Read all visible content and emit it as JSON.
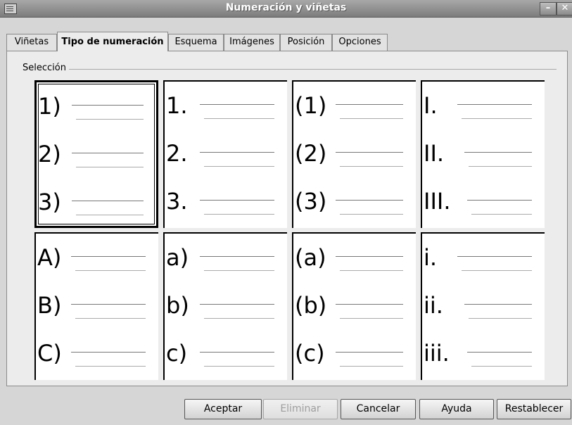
{
  "window": {
    "title": "Numeración y viñetas",
    "minimize": "–",
    "close": "✕"
  },
  "tabs": [
    {
      "label": "Viñetas",
      "active": false
    },
    {
      "label": "Tipo de numeración",
      "active": true
    },
    {
      "label": "Esquema",
      "active": false
    },
    {
      "label": "Imágenes",
      "active": false
    },
    {
      "label": "Posición",
      "active": false
    },
    {
      "label": "Opciones",
      "active": false
    }
  ],
  "section": {
    "label": "Selección"
  },
  "styles": [
    {
      "items": [
        "1)",
        "2)",
        "3)"
      ],
      "selected": true
    },
    {
      "items": [
        "1.",
        "2.",
        "3."
      ],
      "selected": false
    },
    {
      "items": [
        "(1)",
        "(2)",
        "(3)"
      ],
      "selected": false
    },
    {
      "items": [
        "I.",
        "II.",
        "III."
      ],
      "selected": false
    },
    {
      "items": [
        "A)",
        "B)",
        "C)"
      ],
      "selected": false
    },
    {
      "items": [
        "a)",
        "b)",
        "c)"
      ],
      "selected": false
    },
    {
      "items": [
        "(a)",
        "(b)",
        "(c)"
      ],
      "selected": false
    },
    {
      "items": [
        "i.",
        "ii.",
        "iii."
      ],
      "selected": false
    }
  ],
  "buttons": {
    "ok": "Aceptar",
    "delete": "Eliminar",
    "cancel": "Cancelar",
    "help": "Ayuda",
    "reset": "Restablecer"
  }
}
